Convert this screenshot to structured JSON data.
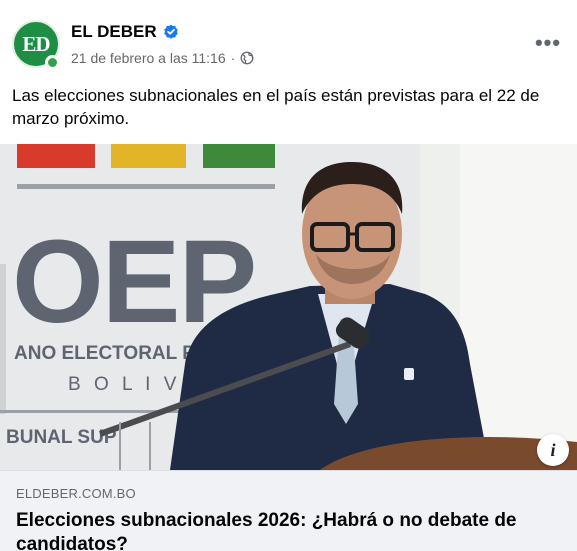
{
  "post": {
    "page_name": "EL DEBER",
    "avatar_text": "ED",
    "timestamp": "21 de febrero a las 11:16",
    "separator": "·",
    "privacy_icon": "globe-icon",
    "verified_icon": "verified-badge-icon",
    "more_label": "•••",
    "text": "Las elecciones subnacionales en el país están previstas para el 22 de marzo próximo."
  },
  "image": {
    "banner_letters": "OEP",
    "banner_line1": "ANO ELECTORAL P",
    "banner_line2": "B O L I V",
    "banner_line3": "BUNAL SUP"
  },
  "link_preview": {
    "domain": "ELDEBER.COM.BO",
    "title": "Elecciones subnacionales 2026: ¿Habrá o no debate de candidatos?",
    "info_label": "i"
  },
  "colors": {
    "brand_green": "#1d8e43",
    "verified_blue": "#1877f2",
    "stripe_red": "#d83b2b",
    "stripe_yellow": "#e2b528",
    "stripe_green": "#3f8a3a"
  }
}
